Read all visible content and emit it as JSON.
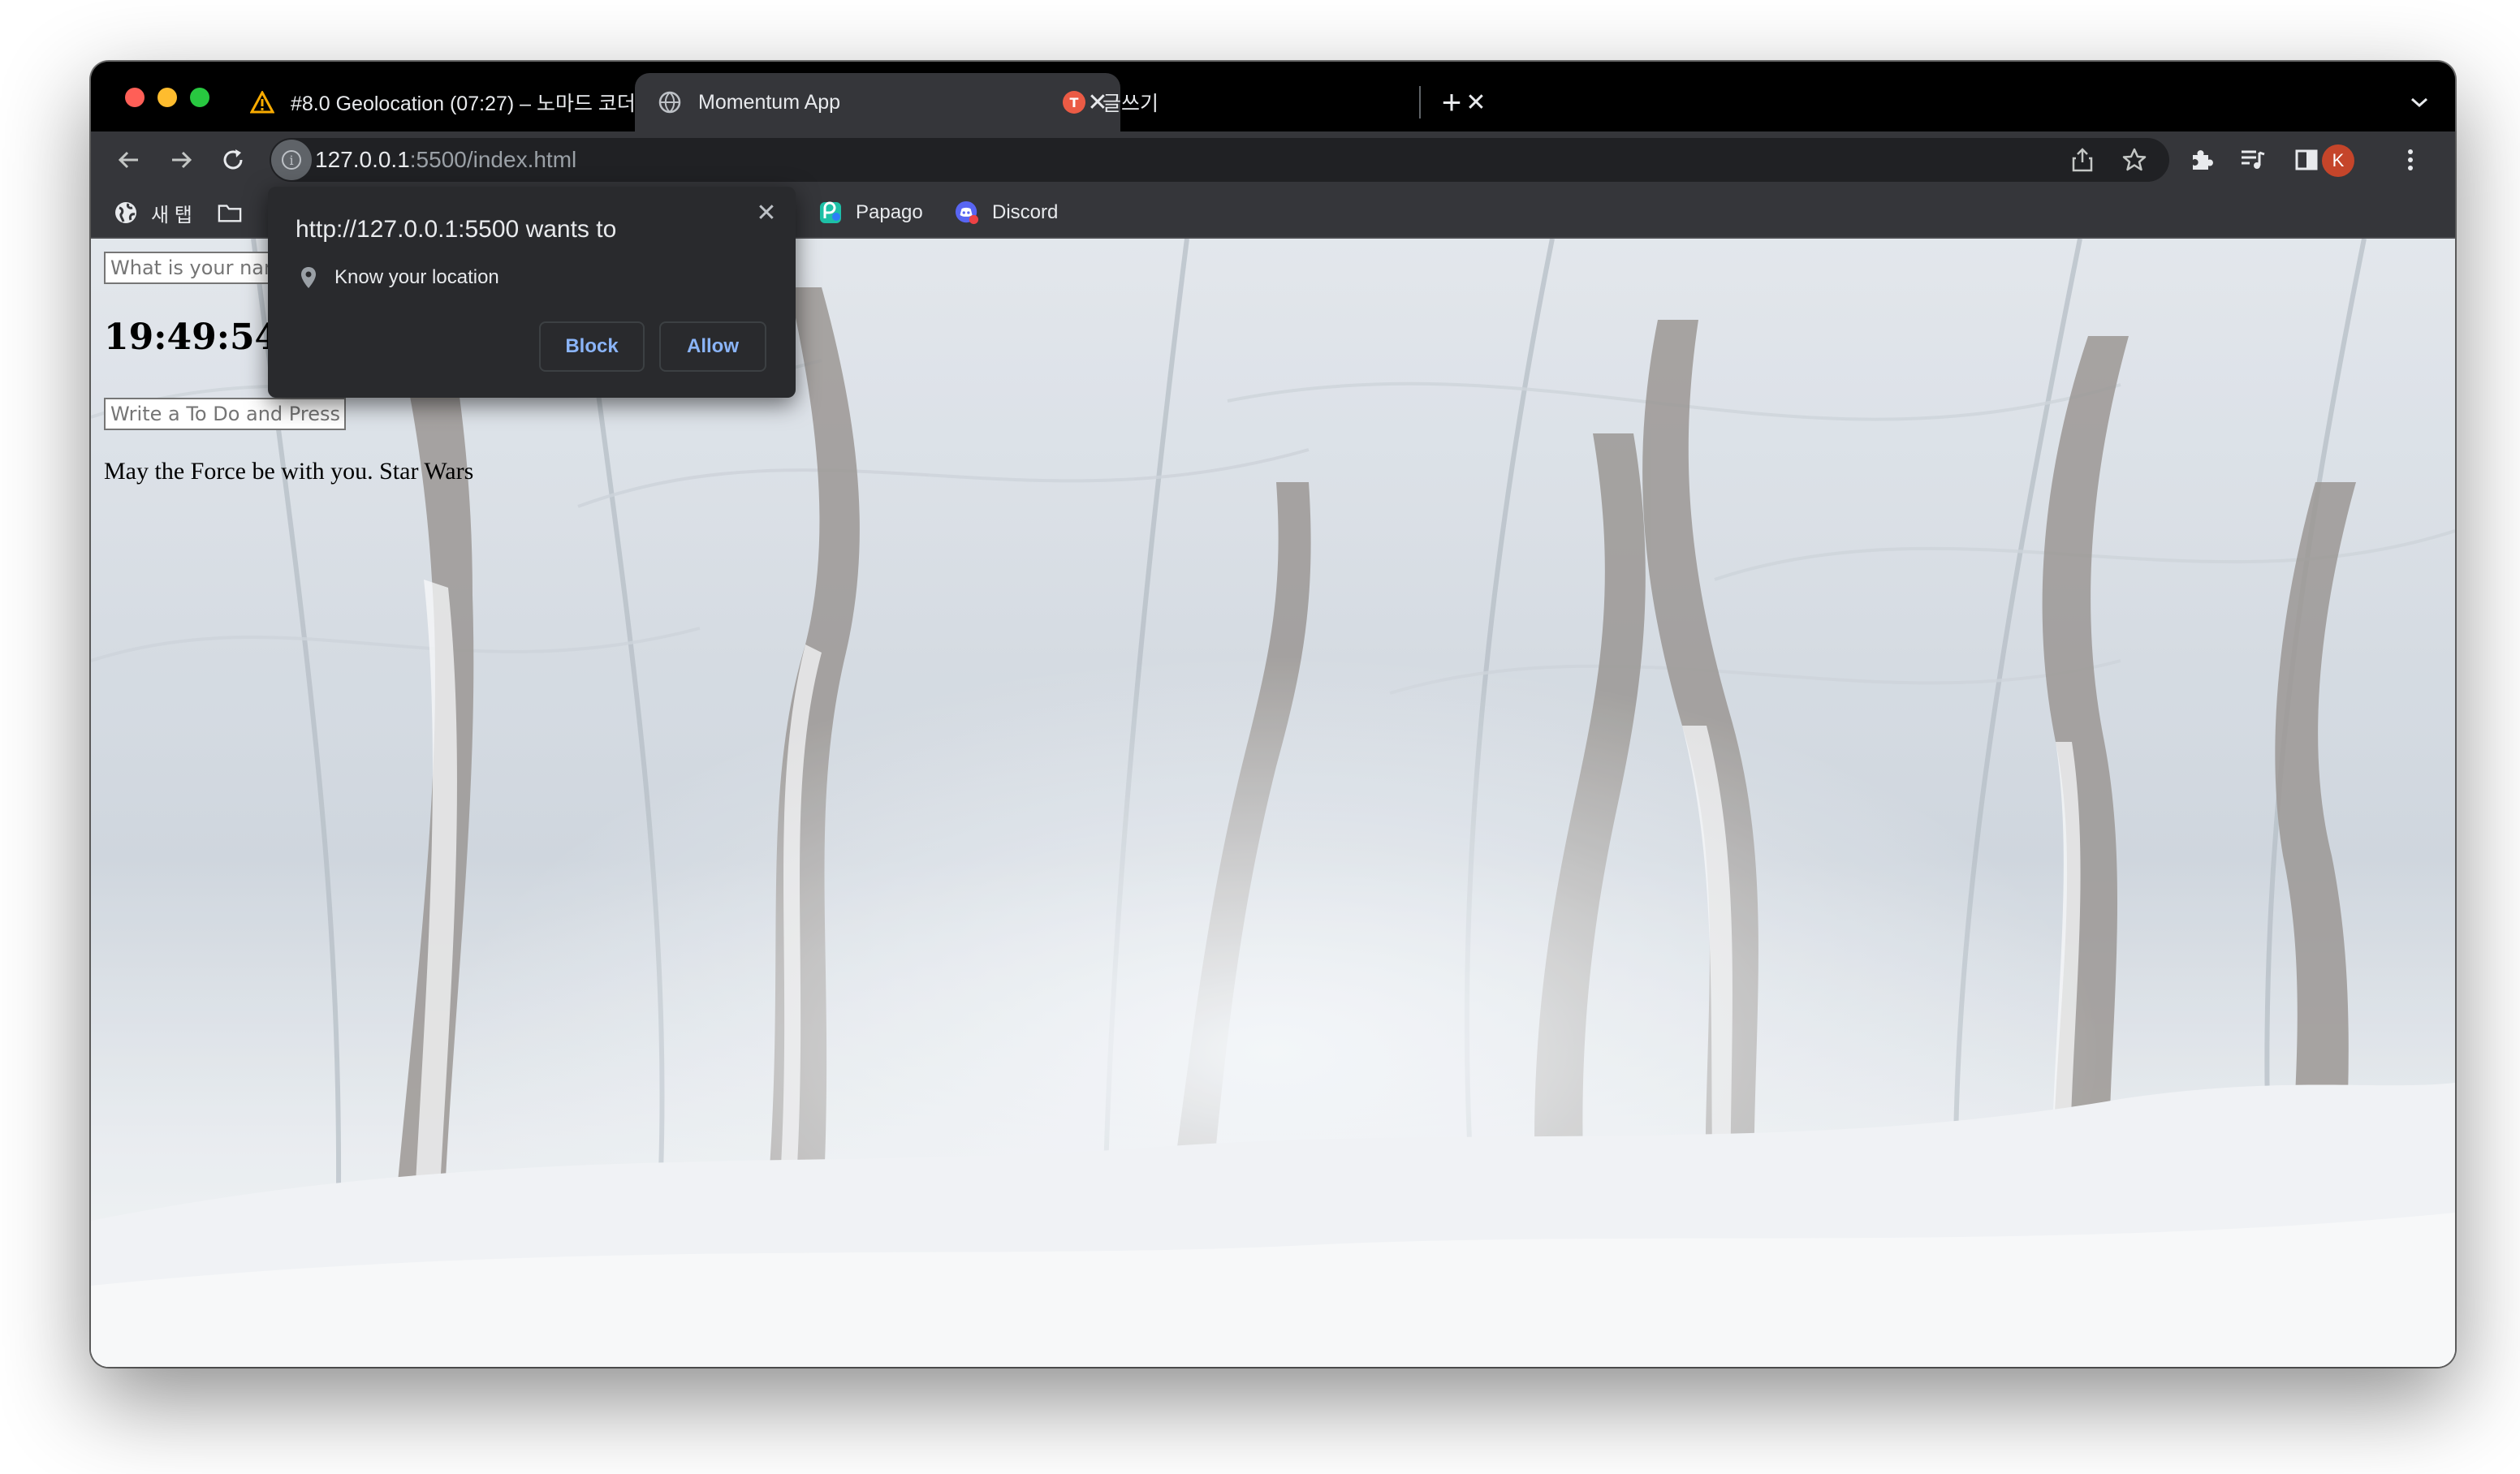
{
  "browser": {
    "tabs": [
      {
        "title": "#8.0 Geolocation (07:27) – 노마드 코더",
        "active": false,
        "favicon": "warning-triangle-icon"
      },
      {
        "title": "Momentum App",
        "active": true,
        "favicon": "globe-icon"
      },
      {
        "title": "글쓰기",
        "active": false,
        "favicon": "tistory-icon"
      }
    ],
    "new_tab_label": "+",
    "url_host": "127.0.0.1",
    "url_path": ":5500/index.html",
    "profile_initial": "K",
    "bookmarks": [
      {
        "label": "새 탭",
        "icon": "globe-icon"
      },
      {
        "label": "",
        "icon": "folder-icon"
      },
      {
        "label": "Papago",
        "icon": "papago-icon"
      },
      {
        "label": "Discord",
        "icon": "discord-icon"
      }
    ]
  },
  "page": {
    "name_placeholder": "What is your name?",
    "clock": "19:49:54",
    "todo_placeholder": "Write a To Do and Press Enter",
    "quote": "May the Force be with you.",
    "author": "Star Wars"
  },
  "permission_prompt": {
    "title": "http://127.0.0.1:5500 wants to",
    "permission": "Know your location",
    "block_label": "Block",
    "allow_label": "Allow"
  },
  "colors": {
    "tabstrip": "#000000",
    "toolbar": "#35363a",
    "accent_link": "#8ab4f8",
    "avatar": "#c5452a"
  }
}
